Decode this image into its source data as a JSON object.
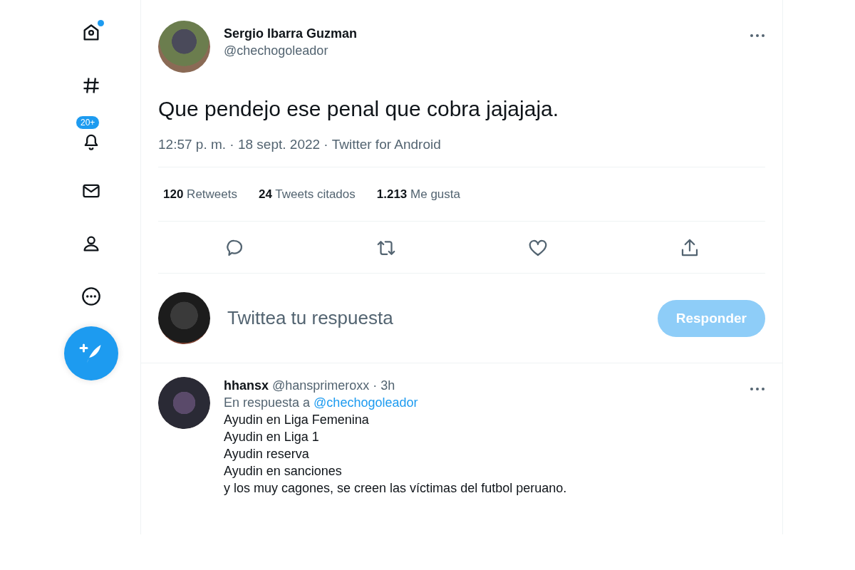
{
  "nav": [
    {
      "kind": "home",
      "dot": true
    },
    {
      "kind": "explore",
      "dot": false
    },
    {
      "kind": "notifications",
      "dot": false,
      "badge": "20+"
    },
    {
      "kind": "messages",
      "dot": false
    },
    {
      "kind": "profile",
      "dot": false
    },
    {
      "kind": "more",
      "dot": false
    }
  ],
  "tweet": {
    "name": "Sergio Ibarra Guzman",
    "handle": "@chechogoleador",
    "text": "Que pendejo ese penal que cobra jajajaja.",
    "meta": "12:57 p. m. · 18 sept. 2022 · Twitter for Android",
    "stats": [
      {
        "count": "120",
        "label": "Retweets"
      },
      {
        "count": "24",
        "label": "Tweets citados"
      },
      {
        "count": "1.213",
        "label": "Me gusta"
      }
    ],
    "actions": [
      {
        "kind": "reply"
      },
      {
        "kind": "retweet"
      },
      {
        "kind": "like"
      },
      {
        "kind": "share"
      }
    ]
  },
  "reply_box": {
    "placeholder": "Twittea tu respuesta",
    "button": "Responder",
    "disabled": true
  },
  "replies": [
    {
      "name": "hhansx",
      "meta": "@hansprimeroxx · 3h",
      "in_reply_prefix": "En respuesta a",
      "in_reply_to": "@chechogoleador",
      "lines": [
        "Ayudin en Liga Femenina",
        "Ayudin en Liga 1",
        "Ayudin reserva",
        "Ayudin en sanciones",
        "y los muy cagones, se creen las víctimas del futbol peruano."
      ]
    }
  ]
}
